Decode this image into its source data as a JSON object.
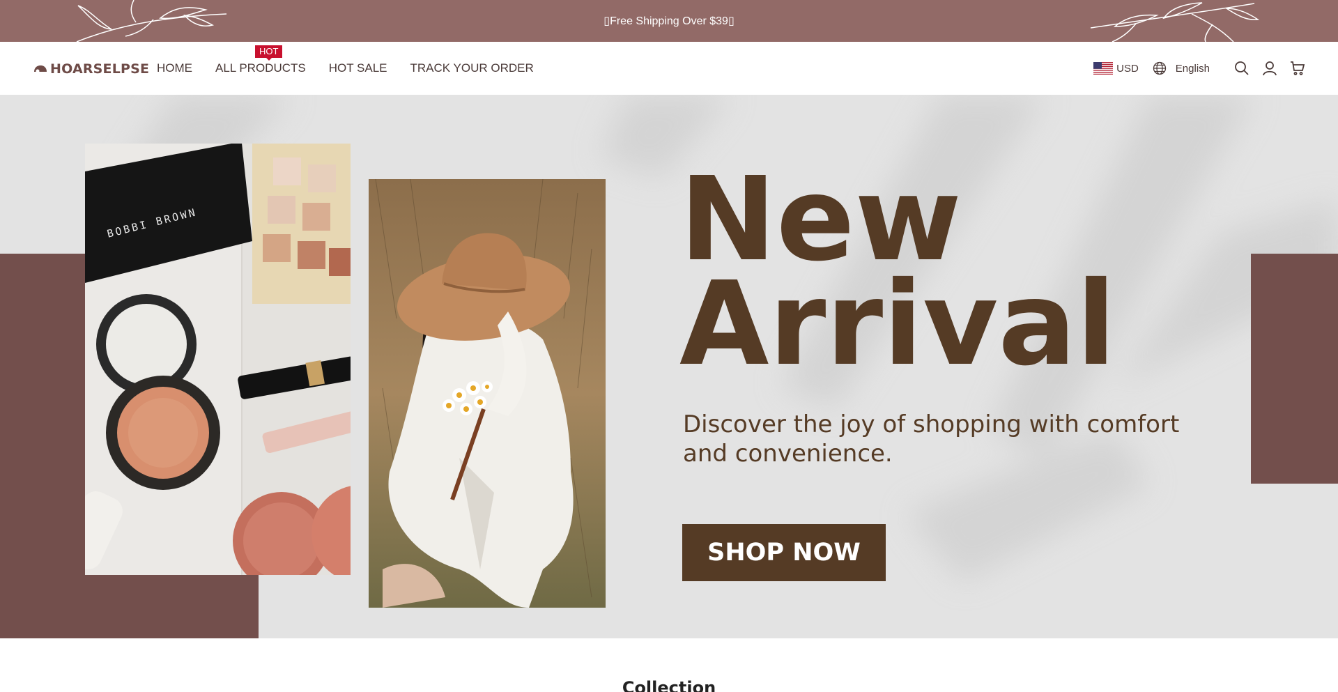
{
  "announcement": {
    "text": "Free Shipping Over $39"
  },
  "brand": {
    "name": "HOARSELPSE"
  },
  "nav": {
    "items": [
      {
        "label": "HOME"
      },
      {
        "label": "ALL PRODUCTS",
        "badge": "HOT"
      },
      {
        "label": "HOT SALE"
      },
      {
        "label": "TRACK YOUR ORDER"
      }
    ]
  },
  "header": {
    "currency": "USD",
    "language": "English",
    "icons": [
      "us-flag-icon",
      "globe-icon",
      "search-icon",
      "user-icon",
      "cart-icon"
    ]
  },
  "hero": {
    "headline_line1": "New",
    "headline_line2": "Arrival",
    "subtext": "Discover the joy of shopping with comfort and convenience.",
    "button_label": "SHOP NOW",
    "photo1_brand_text": "BOBBI BROWN"
  },
  "collection": {
    "title": "Collection"
  },
  "colors": {
    "announcement_bg": "#926a67",
    "accent_block": "#734f4c",
    "hero_text": "#553b25",
    "hero_bg": "#e3e3e3",
    "hot_badge": "#c8102e"
  }
}
